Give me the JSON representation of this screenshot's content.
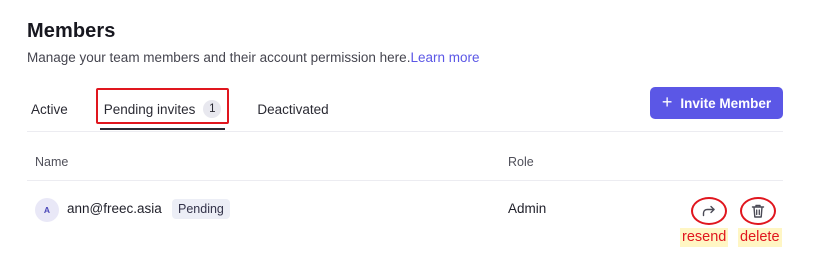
{
  "header": {
    "title": "Members",
    "subtitle": "Manage your team members and their account permission here.",
    "learn_more": "Learn more"
  },
  "tabs": [
    {
      "label": "Active"
    },
    {
      "label": "Pending invites",
      "count": "1",
      "selected": true
    },
    {
      "label": "Deactivated"
    }
  ],
  "invite_button": {
    "label": "Invite Member",
    "icon": "plus-icon"
  },
  "table": {
    "columns": [
      "Name",
      "Role"
    ],
    "rows": [
      {
        "avatar_initial": "A",
        "email": "ann@freec.asia",
        "status": "Pending",
        "role": "Admin",
        "actions": [
          {
            "icon": "share-arrow-icon"
          },
          {
            "icon": "trash-icon"
          }
        ]
      }
    ]
  },
  "annotations": {
    "resend": "resend",
    "delete": "delete"
  },
  "colors": {
    "accent": "#5b57e6",
    "annotation_red": "#e0161e",
    "annotation_bg": "#fff6c4"
  }
}
